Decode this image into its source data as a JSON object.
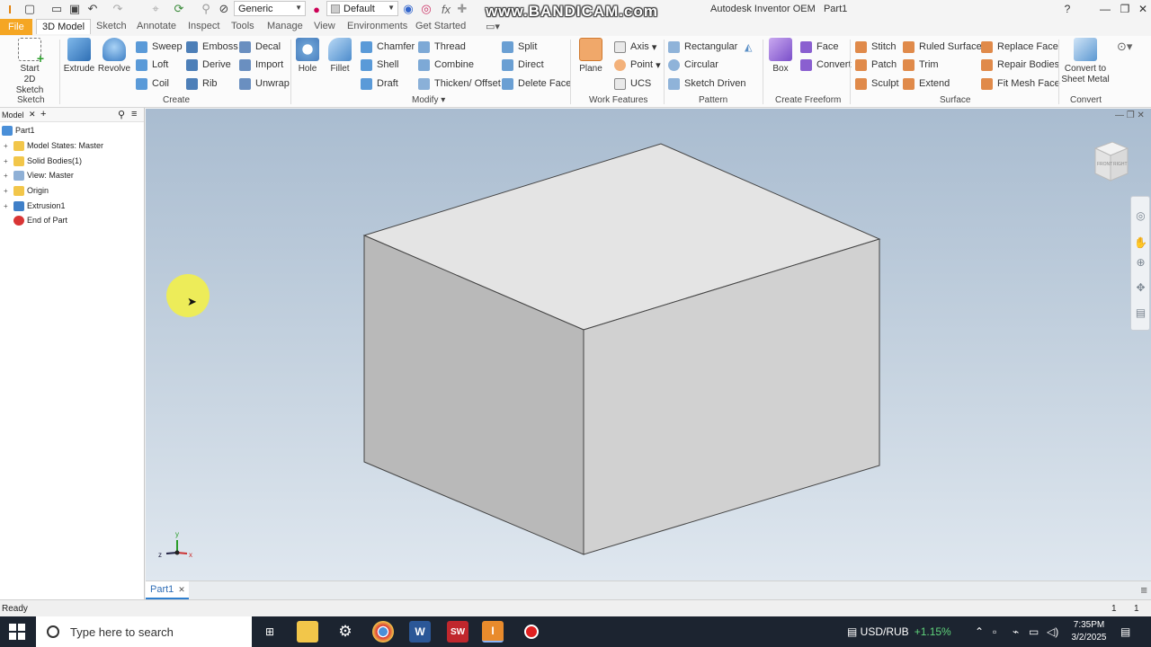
{
  "titlebar": {
    "material": "Generic",
    "appearance": "Default",
    "watermark": "www.BANDICAM.com",
    "title": "Autodesk Inventor OEM",
    "document": "Part1",
    "help_icon": "help-icon"
  },
  "tabs": [
    "File",
    "3D Model",
    "Sketch",
    "Annotate",
    "Inspect",
    "Tools",
    "Manage",
    "View",
    "Environments",
    "Get Started"
  ],
  "ribbon": {
    "sketch": {
      "start_line1": "Start",
      "start_line2": "2D Sketch",
      "label": "Sketch"
    },
    "create": {
      "label": "Create",
      "extrude": "Extrude",
      "revolve": "Revolve",
      "sweep": "Sweep",
      "loft": "Loft",
      "coil": "Coil",
      "emboss": "Emboss",
      "derive": "Derive",
      "rib": "Rib",
      "decal": "Decal",
      "import": "Import",
      "unwrap": "Unwrap"
    },
    "modify": {
      "label": "Modify",
      "hole": "Hole",
      "fillet": "Fillet",
      "chamfer": "Chamfer",
      "shell": "Shell",
      "draft": "Draft",
      "thread": "Thread",
      "combine": "Combine",
      "thicken": "Thicken/ Offset",
      "split": "Split",
      "direct": "Direct",
      "delete_face": "Delete Face"
    },
    "work_features": {
      "label": "Work Features",
      "plane": "Plane",
      "axis": "Axis",
      "point": "Point",
      "ucs": "UCS"
    },
    "pattern": {
      "label": "Pattern",
      "rectangular": "Rectangular",
      "circular": "Circular",
      "sketch_driven": "Sketch Driven"
    },
    "freeform": {
      "label": "Create Freeform",
      "box": "Box",
      "face": "Face",
      "convert": "Convert"
    },
    "surface": {
      "label": "Surface",
      "stitch": "Stitch",
      "patch": "Patch",
      "sculpt": "Sculpt",
      "ruled_surface": "Ruled Surface",
      "trim": "Trim",
      "extend": "Extend",
      "replace_face": "Replace Face",
      "repair_bodies": "Repair Bodies",
      "fit_mesh_face": "Fit Mesh Face"
    },
    "convert": {
      "label": "Convert",
      "line1": "Convert to",
      "line2": "Sheet Metal"
    }
  },
  "browser": {
    "tab": "Model",
    "items": [
      {
        "label": "Part1",
        "icon": "part-icon"
      },
      {
        "label": "Model States: Master",
        "icon": "folder-icon"
      },
      {
        "label": "Solid Bodies(1)",
        "icon": "folder-icon"
      },
      {
        "label": "View: Master",
        "icon": "view-icon"
      },
      {
        "label": "Origin",
        "icon": "folder-icon"
      },
      {
        "label": "Extrusion1",
        "icon": "extrusion-icon"
      },
      {
        "label": "End of Part",
        "icon": "end-of-part-icon"
      }
    ]
  },
  "viewcube": {
    "front": "FRONT",
    "right": "RIGHT"
  },
  "axes": {
    "x": "x",
    "y": "y",
    "z": "z"
  },
  "doc_tab": "Part1",
  "status": {
    "text": "Ready",
    "count1": "1",
    "count2": "1"
  },
  "taskbar": {
    "search_placeholder": "Type here to search",
    "stock": "USD/RUB",
    "stock_change": "+1.15%",
    "time": "7:35PM",
    "date": "3/2/2025"
  },
  "colors": {
    "accent": "#f5a623",
    "selection": "#2f7fcf",
    "stock_up": "#5fd37b"
  }
}
